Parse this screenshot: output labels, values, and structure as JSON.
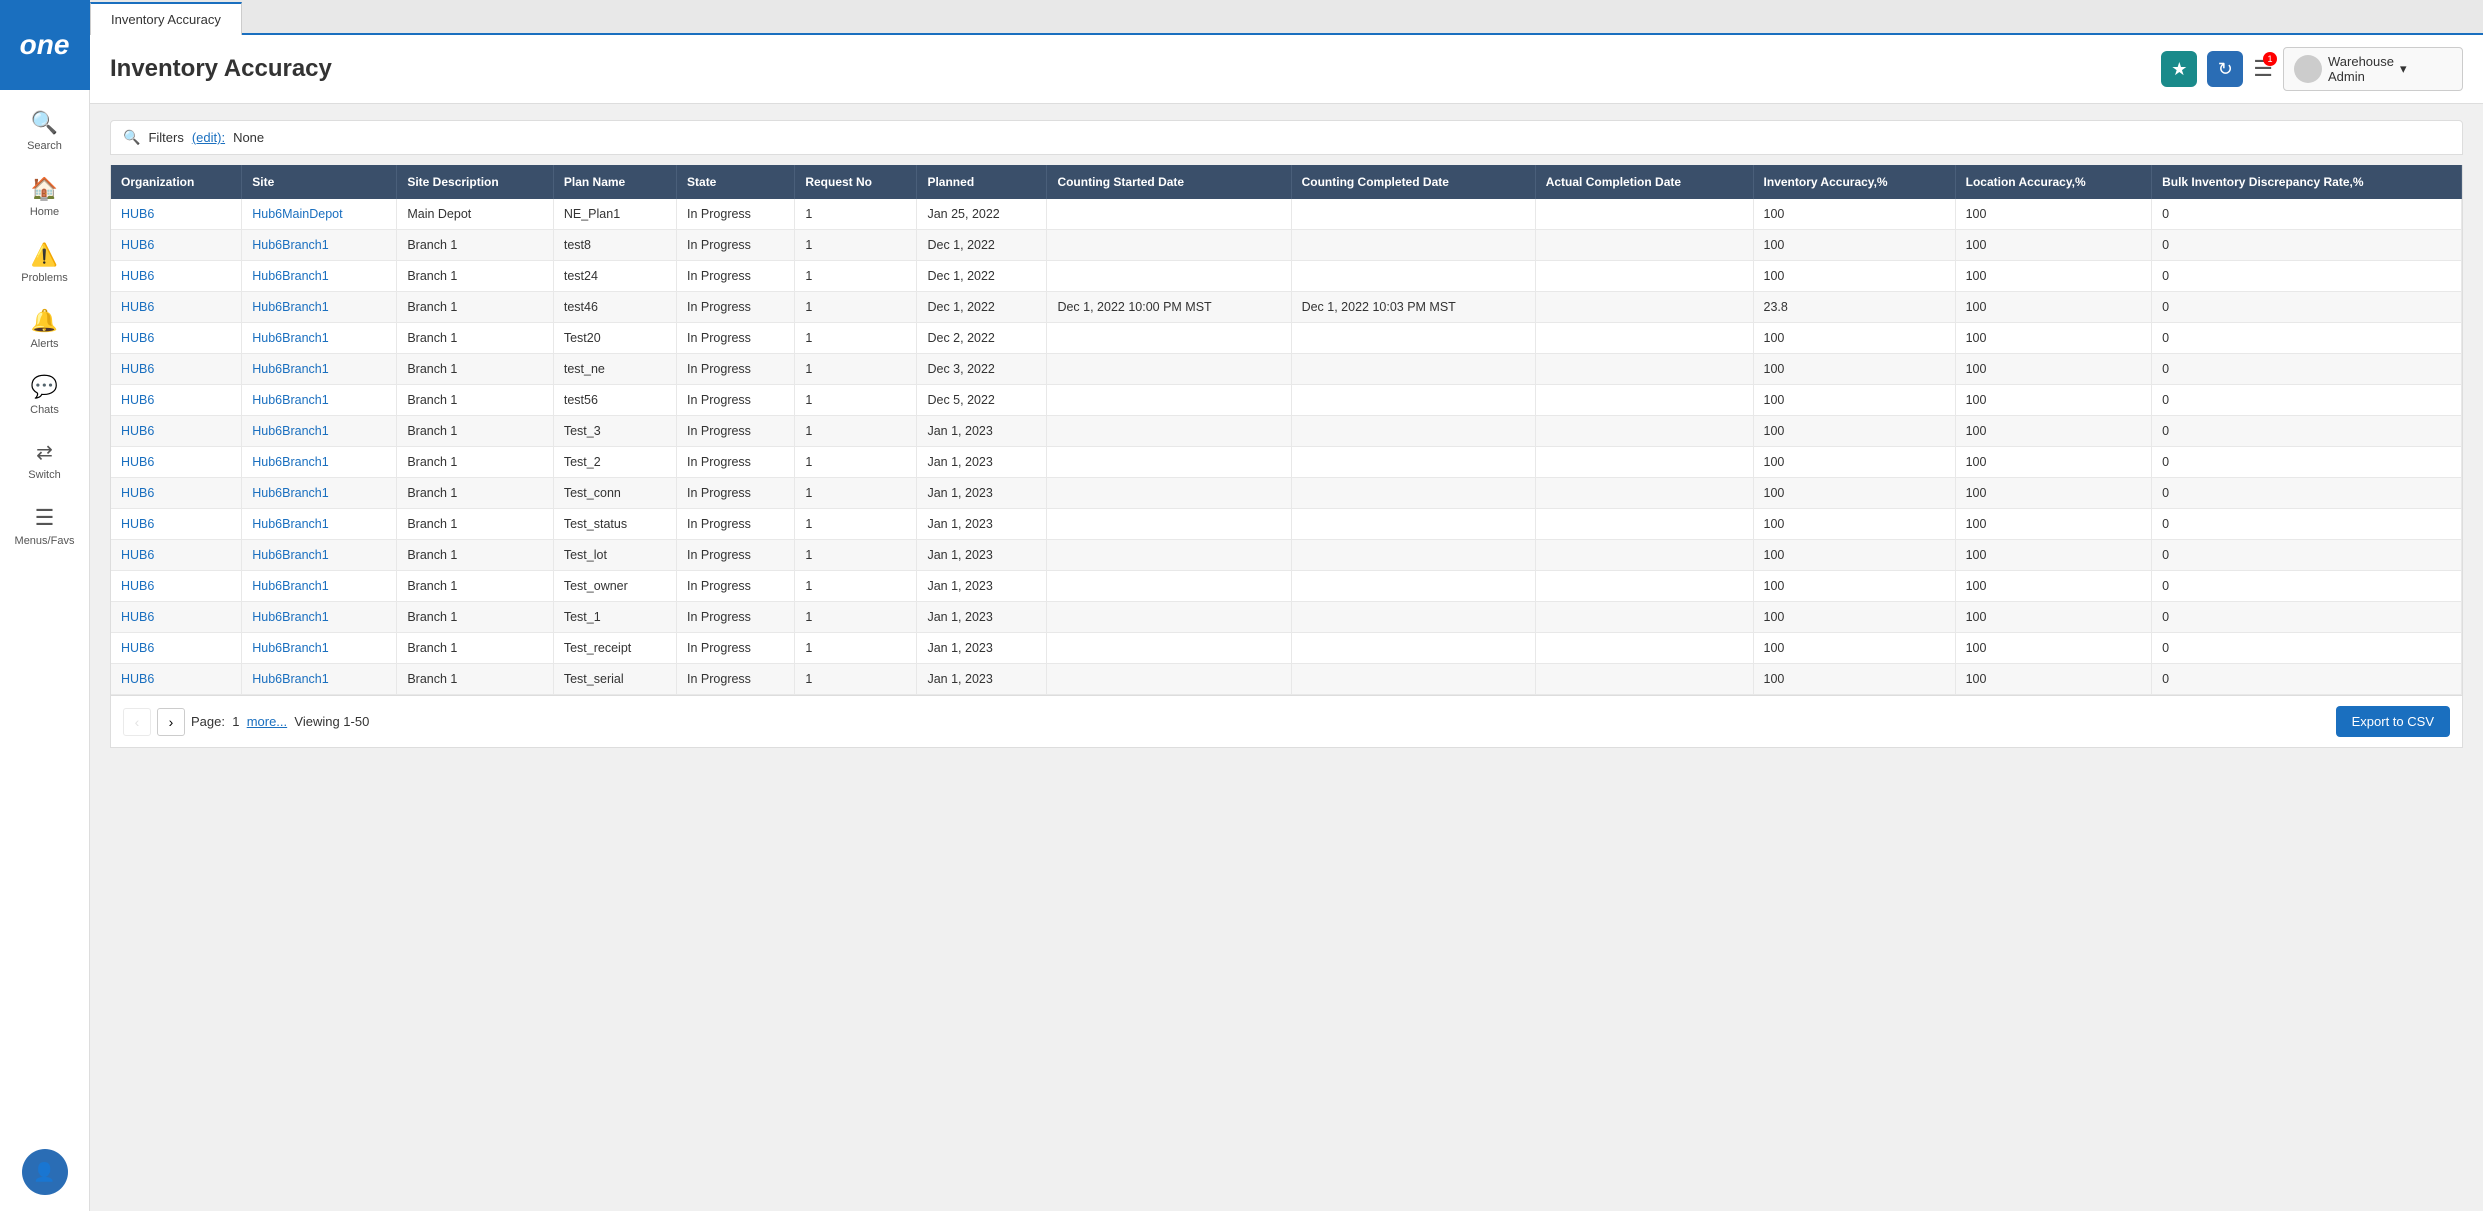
{
  "app": {
    "logo_text": "one",
    "tab_label": "Inventory Accuracy"
  },
  "sidebar": {
    "items": [
      {
        "id": "search",
        "icon": "🔍",
        "label": "Search"
      },
      {
        "id": "home",
        "icon": "🏠",
        "label": "Home"
      },
      {
        "id": "problems",
        "icon": "⚠️",
        "label": "Problems"
      },
      {
        "id": "alerts",
        "icon": "🔔",
        "label": "Alerts"
      },
      {
        "id": "chats",
        "icon": "💬",
        "label": "Chats"
      },
      {
        "id": "switch",
        "icon": "⇄",
        "label": "Switch"
      },
      {
        "id": "menus",
        "icon": "☰",
        "label": "Menus/Favs"
      }
    ]
  },
  "header": {
    "title": "Inventory Accuracy",
    "favorite_label": "★",
    "refresh_label": "↻",
    "menu_label": "☰",
    "user_name": "Warehouse Admin",
    "dropdown_arrow": "▾"
  },
  "filters": {
    "label": "Filters",
    "edit_label": "(edit):",
    "value": "None"
  },
  "table": {
    "columns": [
      "Organization",
      "Site",
      "Site Description",
      "Plan Name",
      "State",
      "Request No",
      "Planned",
      "Counting Started Date",
      "Counting Completed Date",
      "Actual Completion Date",
      "Inventory Accuracy,%",
      "Location Accuracy,%",
      "Bulk Inventory Discrepancy Rate,%"
    ],
    "rows": [
      {
        "org": "HUB6",
        "site": "Hub6MainDepot",
        "desc": "Main Depot",
        "plan": "NE_Plan1",
        "state": "In Progress",
        "req": "1",
        "planned": "Jan 25, 2022",
        "cnt_start": "",
        "cnt_end": "",
        "actual_end": "",
        "inv_acc": "100",
        "loc_acc": "100",
        "bulk_disc": "0"
      },
      {
        "org": "HUB6",
        "site": "Hub6Branch1",
        "desc": "Branch 1",
        "plan": "test8",
        "state": "In Progress",
        "req": "1",
        "planned": "Dec 1, 2022",
        "cnt_start": "",
        "cnt_end": "",
        "actual_end": "",
        "inv_acc": "100",
        "loc_acc": "100",
        "bulk_disc": "0"
      },
      {
        "org": "HUB6",
        "site": "Hub6Branch1",
        "desc": "Branch 1",
        "plan": "test24",
        "state": "In Progress",
        "req": "1",
        "planned": "Dec 1, 2022",
        "cnt_start": "",
        "cnt_end": "",
        "actual_end": "",
        "inv_acc": "100",
        "loc_acc": "100",
        "bulk_disc": "0"
      },
      {
        "org": "HUB6",
        "site": "Hub6Branch1",
        "desc": "Branch 1",
        "plan": "test46",
        "state": "In Progress",
        "req": "1",
        "planned": "Dec 1, 2022",
        "cnt_start": "Dec 1, 2022 10:00 PM MST",
        "cnt_end": "Dec 1, 2022 10:03 PM MST",
        "actual_end": "",
        "inv_acc": "23.8",
        "loc_acc": "100",
        "bulk_disc": "0"
      },
      {
        "org": "HUB6",
        "site": "Hub6Branch1",
        "desc": "Branch 1",
        "plan": "Test20",
        "state": "In Progress",
        "req": "1",
        "planned": "Dec 2, 2022",
        "cnt_start": "",
        "cnt_end": "",
        "actual_end": "",
        "inv_acc": "100",
        "loc_acc": "100",
        "bulk_disc": "0"
      },
      {
        "org": "HUB6",
        "site": "Hub6Branch1",
        "desc": "Branch 1",
        "plan": "test_ne",
        "state": "In Progress",
        "req": "1",
        "planned": "Dec 3, 2022",
        "cnt_start": "",
        "cnt_end": "",
        "actual_end": "",
        "inv_acc": "100",
        "loc_acc": "100",
        "bulk_disc": "0"
      },
      {
        "org": "HUB6",
        "site": "Hub6Branch1",
        "desc": "Branch 1",
        "plan": "test56",
        "state": "In Progress",
        "req": "1",
        "planned": "Dec 5, 2022",
        "cnt_start": "",
        "cnt_end": "",
        "actual_end": "",
        "inv_acc": "100",
        "loc_acc": "100",
        "bulk_disc": "0"
      },
      {
        "org": "HUB6",
        "site": "Hub6Branch1",
        "desc": "Branch 1",
        "plan": "Test_3",
        "state": "In Progress",
        "req": "1",
        "planned": "Jan 1, 2023",
        "cnt_start": "",
        "cnt_end": "",
        "actual_end": "",
        "inv_acc": "100",
        "loc_acc": "100",
        "bulk_disc": "0"
      },
      {
        "org": "HUB6",
        "site": "Hub6Branch1",
        "desc": "Branch 1",
        "plan": "Test_2",
        "state": "In Progress",
        "req": "1",
        "planned": "Jan 1, 2023",
        "cnt_start": "",
        "cnt_end": "",
        "actual_end": "",
        "inv_acc": "100",
        "loc_acc": "100",
        "bulk_disc": "0"
      },
      {
        "org": "HUB6",
        "site": "Hub6Branch1",
        "desc": "Branch 1",
        "plan": "Test_conn",
        "state": "In Progress",
        "req": "1",
        "planned": "Jan 1, 2023",
        "cnt_start": "",
        "cnt_end": "",
        "actual_end": "",
        "inv_acc": "100",
        "loc_acc": "100",
        "bulk_disc": "0"
      },
      {
        "org": "HUB6",
        "site": "Hub6Branch1",
        "desc": "Branch 1",
        "plan": "Test_status",
        "state": "In Progress",
        "req": "1",
        "planned": "Jan 1, 2023",
        "cnt_start": "",
        "cnt_end": "",
        "actual_end": "",
        "inv_acc": "100",
        "loc_acc": "100",
        "bulk_disc": "0"
      },
      {
        "org": "HUB6",
        "site": "Hub6Branch1",
        "desc": "Branch 1",
        "plan": "Test_lot",
        "state": "In Progress",
        "req": "1",
        "planned": "Jan 1, 2023",
        "cnt_start": "",
        "cnt_end": "",
        "actual_end": "",
        "inv_acc": "100",
        "loc_acc": "100",
        "bulk_disc": "0"
      },
      {
        "org": "HUB6",
        "site": "Hub6Branch1",
        "desc": "Branch 1",
        "plan": "Test_owner",
        "state": "In Progress",
        "req": "1",
        "planned": "Jan 1, 2023",
        "cnt_start": "",
        "cnt_end": "",
        "actual_end": "",
        "inv_acc": "100",
        "loc_acc": "100",
        "bulk_disc": "0"
      },
      {
        "org": "HUB6",
        "site": "Hub6Branch1",
        "desc": "Branch 1",
        "plan": "Test_1",
        "state": "In Progress",
        "req": "1",
        "planned": "Jan 1, 2023",
        "cnt_start": "",
        "cnt_end": "",
        "actual_end": "",
        "inv_acc": "100",
        "loc_acc": "100",
        "bulk_disc": "0"
      },
      {
        "org": "HUB6",
        "site": "Hub6Branch1",
        "desc": "Branch 1",
        "plan": "Test_receipt",
        "state": "In Progress",
        "req": "1",
        "planned": "Jan 1, 2023",
        "cnt_start": "",
        "cnt_end": "",
        "actual_end": "",
        "inv_acc": "100",
        "loc_acc": "100",
        "bulk_disc": "0"
      },
      {
        "org": "HUB6",
        "site": "Hub6Branch1",
        "desc": "Branch 1",
        "plan": "Test_serial",
        "state": "In Progress",
        "req": "1",
        "planned": "Jan 1, 2023",
        "cnt_start": "",
        "cnt_end": "",
        "actual_end": "",
        "inv_acc": "100",
        "loc_acc": "100",
        "bulk_disc": "0"
      }
    ]
  },
  "pagination": {
    "prev_label": "‹",
    "next_label": "›",
    "page_prefix": "Page:",
    "page_number": "1",
    "more_label": "more...",
    "viewing_label": "Viewing 1-50",
    "export_label": "Export to CSV"
  }
}
